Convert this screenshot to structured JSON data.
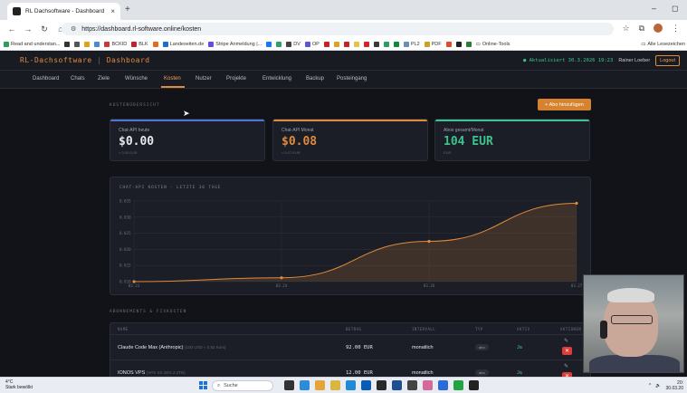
{
  "browser": {
    "tab_title": "RL Dachsoftware - Dashboard",
    "url": "https://dashboard.rl-software.online/kosten",
    "bookmarks": [
      "Read and understan...",
      "BCKID",
      "BLK",
      "Landeseiten.de",
      "Stripe Anmeldung |...",
      "DV",
      "OP",
      "PL2",
      "PDF",
      "Online-Tools",
      "Alle Lesezeichen"
    ]
  },
  "app": {
    "brand_left": "RL-Dachsoftware",
    "brand_sep": "|",
    "brand_right": "Dashboard",
    "updated": "● Aktualisiert 30.3.2026 19:23",
    "user": "Rainer Loeber",
    "logout": "Logout"
  },
  "nav": {
    "items": [
      "Dashboard",
      "Chats",
      "Ziele",
      "Wünsche",
      "Kosten",
      "Nutzer",
      "Projekte",
      "Entwicklung",
      "Backup",
      "Posteingang"
    ],
    "active": "Kosten"
  },
  "overview": {
    "section_label": "KOSTENÜBERSICHT",
    "add_button": "+ Abo hinzufügen",
    "cards": [
      {
        "label": "Chat-API heute",
        "value": "$0.00",
        "sub": "≈ 0.00 EUR",
        "color": "#e6e8ec",
        "accent": "#4f73d9"
      },
      {
        "label": "Chat-API Monat",
        "value": "$0.08",
        "sub": "≈ 0.07 EUR",
        "color": "#e08a3c",
        "accent": "#e08a3c"
      },
      {
        "label": "Abos gesamt/Monat",
        "value": "104 EUR",
        "sub": "EUR",
        "color": "#3ec28f",
        "accent": "#3ec28f"
      }
    ]
  },
  "chart_data": {
    "type": "area",
    "title": "CHAT-API KOSTEN - LETZTE 30 TAGE",
    "x": [
      "03.23",
      "03.24",
      "03.26",
      "03.27"
    ],
    "series": [
      {
        "values": [
          0.01,
          0.0112,
          0.0225,
          0.0343
        ]
      }
    ],
    "y_ticks": [
      "0.035",
      "0.030",
      "0.025",
      "0.020",
      "0.015",
      "0.010"
    ],
    "ylim": [
      0.01,
      0.035
    ],
    "color": "#e08a3c",
    "grid": true
  },
  "subscriptions": {
    "section_label": "ABONNEMENTS & FIXKOSTEN",
    "headers": [
      "NAME",
      "BETRAG",
      "INTERVALL",
      "TYP",
      "AKTIV",
      "AKTIONEN"
    ],
    "rows": [
      {
        "name": "Claude Code Max (Anthropic)",
        "note": "(100 USD ≈ 0.92 Kurs)",
        "amount": "92.00 EUR",
        "interval": "monatlich",
        "type": "abo",
        "active": "Ja"
      },
      {
        "name": "IONOS VPS",
        "note": "(VPS XS 18% 2.2TB)",
        "amount": "12.00 EUR",
        "interval": "monatlich",
        "type": "abo",
        "active": "Ja"
      }
    ]
  },
  "taskbar": {
    "weather_temp": "4°C",
    "weather_text": "Stark bewölkt",
    "search": "Suche",
    "time": "20:",
    "date": "30.03.20"
  }
}
